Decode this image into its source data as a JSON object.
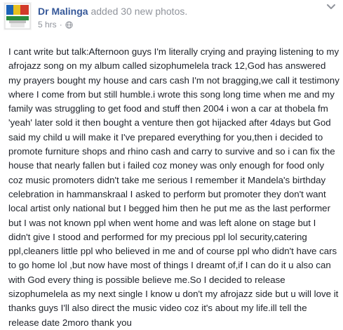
{
  "post": {
    "author": "Dr Malinga",
    "action": " added 30 new photos.",
    "timestamp": "5 hrs",
    "separator": "·",
    "audience_icon": "globe-icon",
    "menu_icon": "chevron-down-icon",
    "body": "I cant write but talk:Afternoon guys I'm literally crying and praying listening to my afrojazz song on my album called sizophumelela track 12,God has answered my prayers bought my house and cars cash I'm not bragging,we call it testimony where I come from but still humble.i wrote this song long time when me and my family was struggling to get food and stuff then 2004 i won a car at thobela fm 'yeah' later sold it then bought a venture then got hijacked after 4days but God said my child u will make it I've prepared everything for you,then i decided to promote furniture shops and rhino cash and carry to survive and so i can fix the house that nearly fallen but i failed coz money was only enough for food only coz music promoters didn't take me serious I remember it Mandela's birthday celebration in hammanskraal I asked to perform but promoter they don't want local artist only national but I begged him then he put me as the last performer but I was not known ppl when went home and was left alone on stage but I didn't give I stood and performed for my precious ppl lol security,catering ppl,cleaners little ppl who believed in me and of course ppl who didn't have cars to go home lol ,but now have most of things I dreamt of,if I can do it u also can with God every thing is possible believe me.So I decided to release sizophumelela as my next single I know u don't my afrojazz side but u will love it thanks guys I'll also direct the music video coz it's about my life.ill tell the release date 2moro thank you"
  },
  "colors": {
    "author_link": "#365899",
    "meta_gray": "#90949c",
    "body_text": "#1d2129"
  }
}
